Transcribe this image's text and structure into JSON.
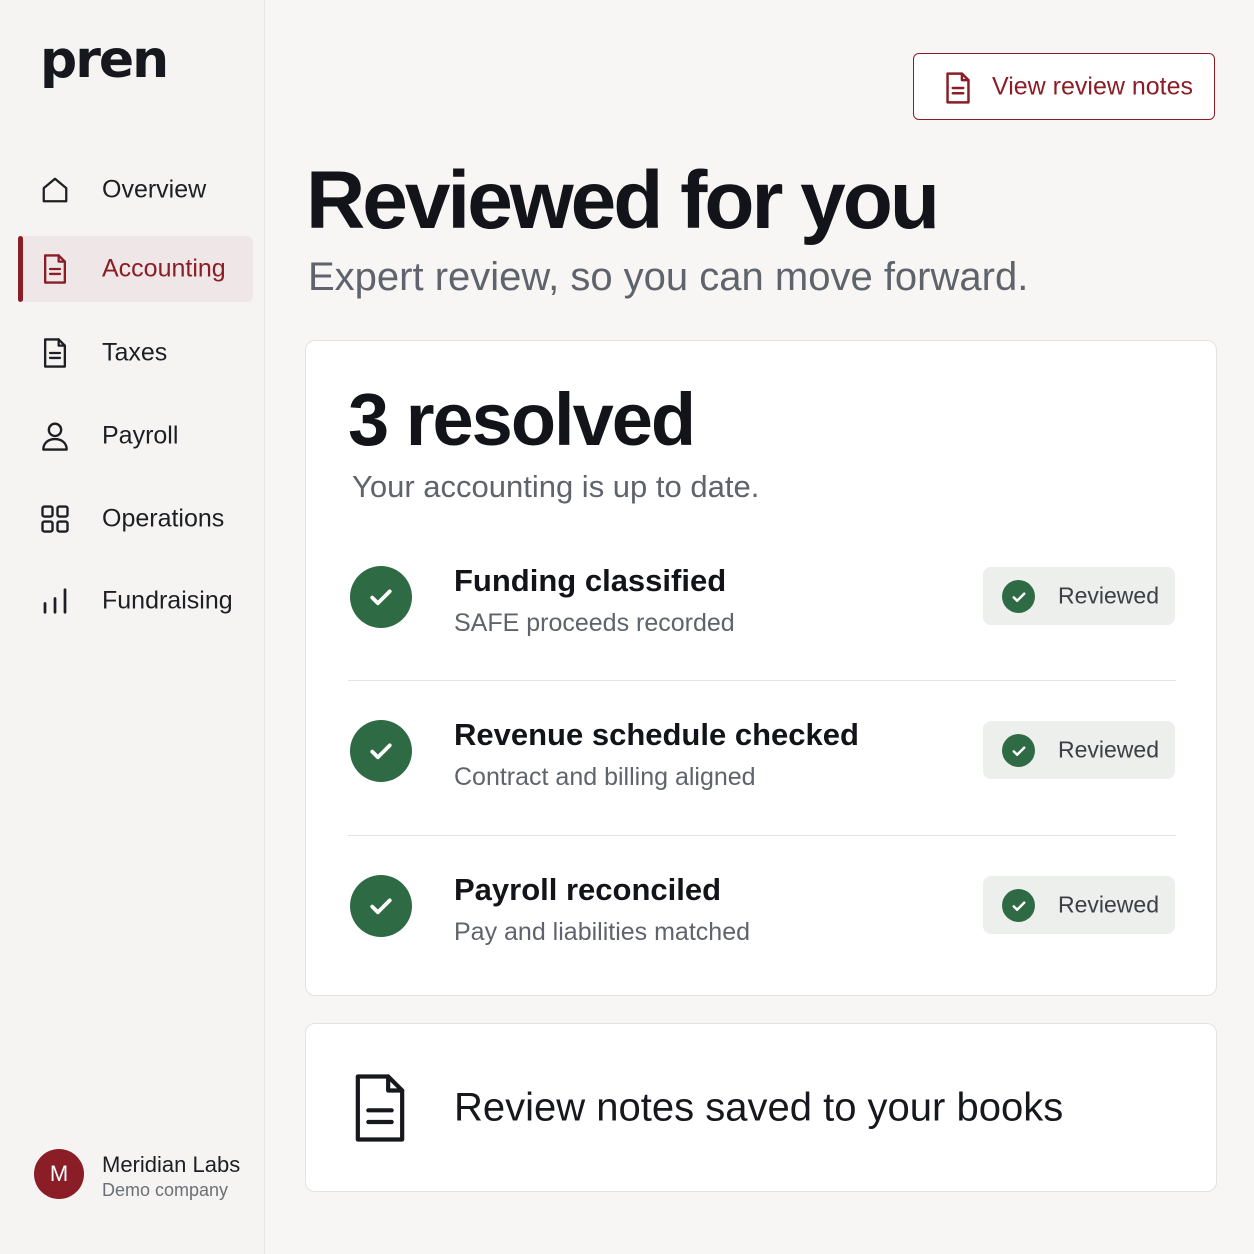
{
  "brand": {
    "logo_text": "pren"
  },
  "colors": {
    "accent": "#8b1d26",
    "success": "#2e6b45",
    "background": "#f7f6f4"
  },
  "sidebar": {
    "items": [
      {
        "label": "Overview",
        "icon": "home-icon",
        "active": false
      },
      {
        "label": "Accounting",
        "icon": "document-icon",
        "active": true
      },
      {
        "label": "Taxes",
        "icon": "document-icon",
        "active": false
      },
      {
        "label": "Payroll",
        "icon": "user-icon",
        "active": false
      },
      {
        "label": "Operations",
        "icon": "grid-icon",
        "active": false
      },
      {
        "label": "Fundraising",
        "icon": "bar-chart-icon",
        "active": false
      }
    ],
    "company": {
      "initial": "M",
      "name": "Meridian Labs",
      "subtitle": "Demo company"
    }
  },
  "header": {
    "notes_button_label": "View review notes"
  },
  "main": {
    "title": "Reviewed for you",
    "subtitle": "Expert review, so you can move forward.",
    "summary": {
      "count_label": "3 resolved",
      "status_text": "Your accounting is up to date.",
      "items": [
        {
          "title": "Funding classified",
          "subtitle": "SAFE proceeds recorded",
          "badge": "Reviewed"
        },
        {
          "title": "Revenue schedule checked",
          "subtitle": "Contract and billing aligned",
          "badge": "Reviewed"
        },
        {
          "title": "Payroll reconciled",
          "subtitle": "Pay and liabilities matched",
          "badge": "Reviewed"
        }
      ]
    },
    "notes_banner": {
      "text": "Review notes saved to your books"
    }
  }
}
